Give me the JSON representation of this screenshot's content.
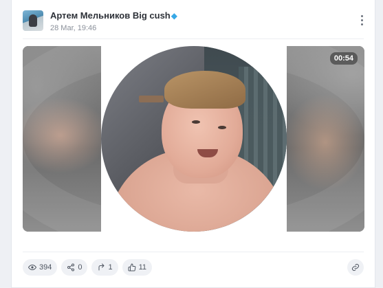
{
  "post": {
    "author": "Артем Мельников Big cush",
    "author_badge_icon": "diamond-icon",
    "date": "28 Mar, 19:46",
    "menu_icon": "more-vertical-icon"
  },
  "media": {
    "duration": "00:54"
  },
  "stats": {
    "views": "394",
    "shares": "0",
    "forwards": "1",
    "likes": "11"
  },
  "actions": {
    "link_icon": "link-icon"
  },
  "colors": {
    "accent": "#37a8e6",
    "chip_bg": "#eff1f5",
    "text": "#2d3138"
  }
}
